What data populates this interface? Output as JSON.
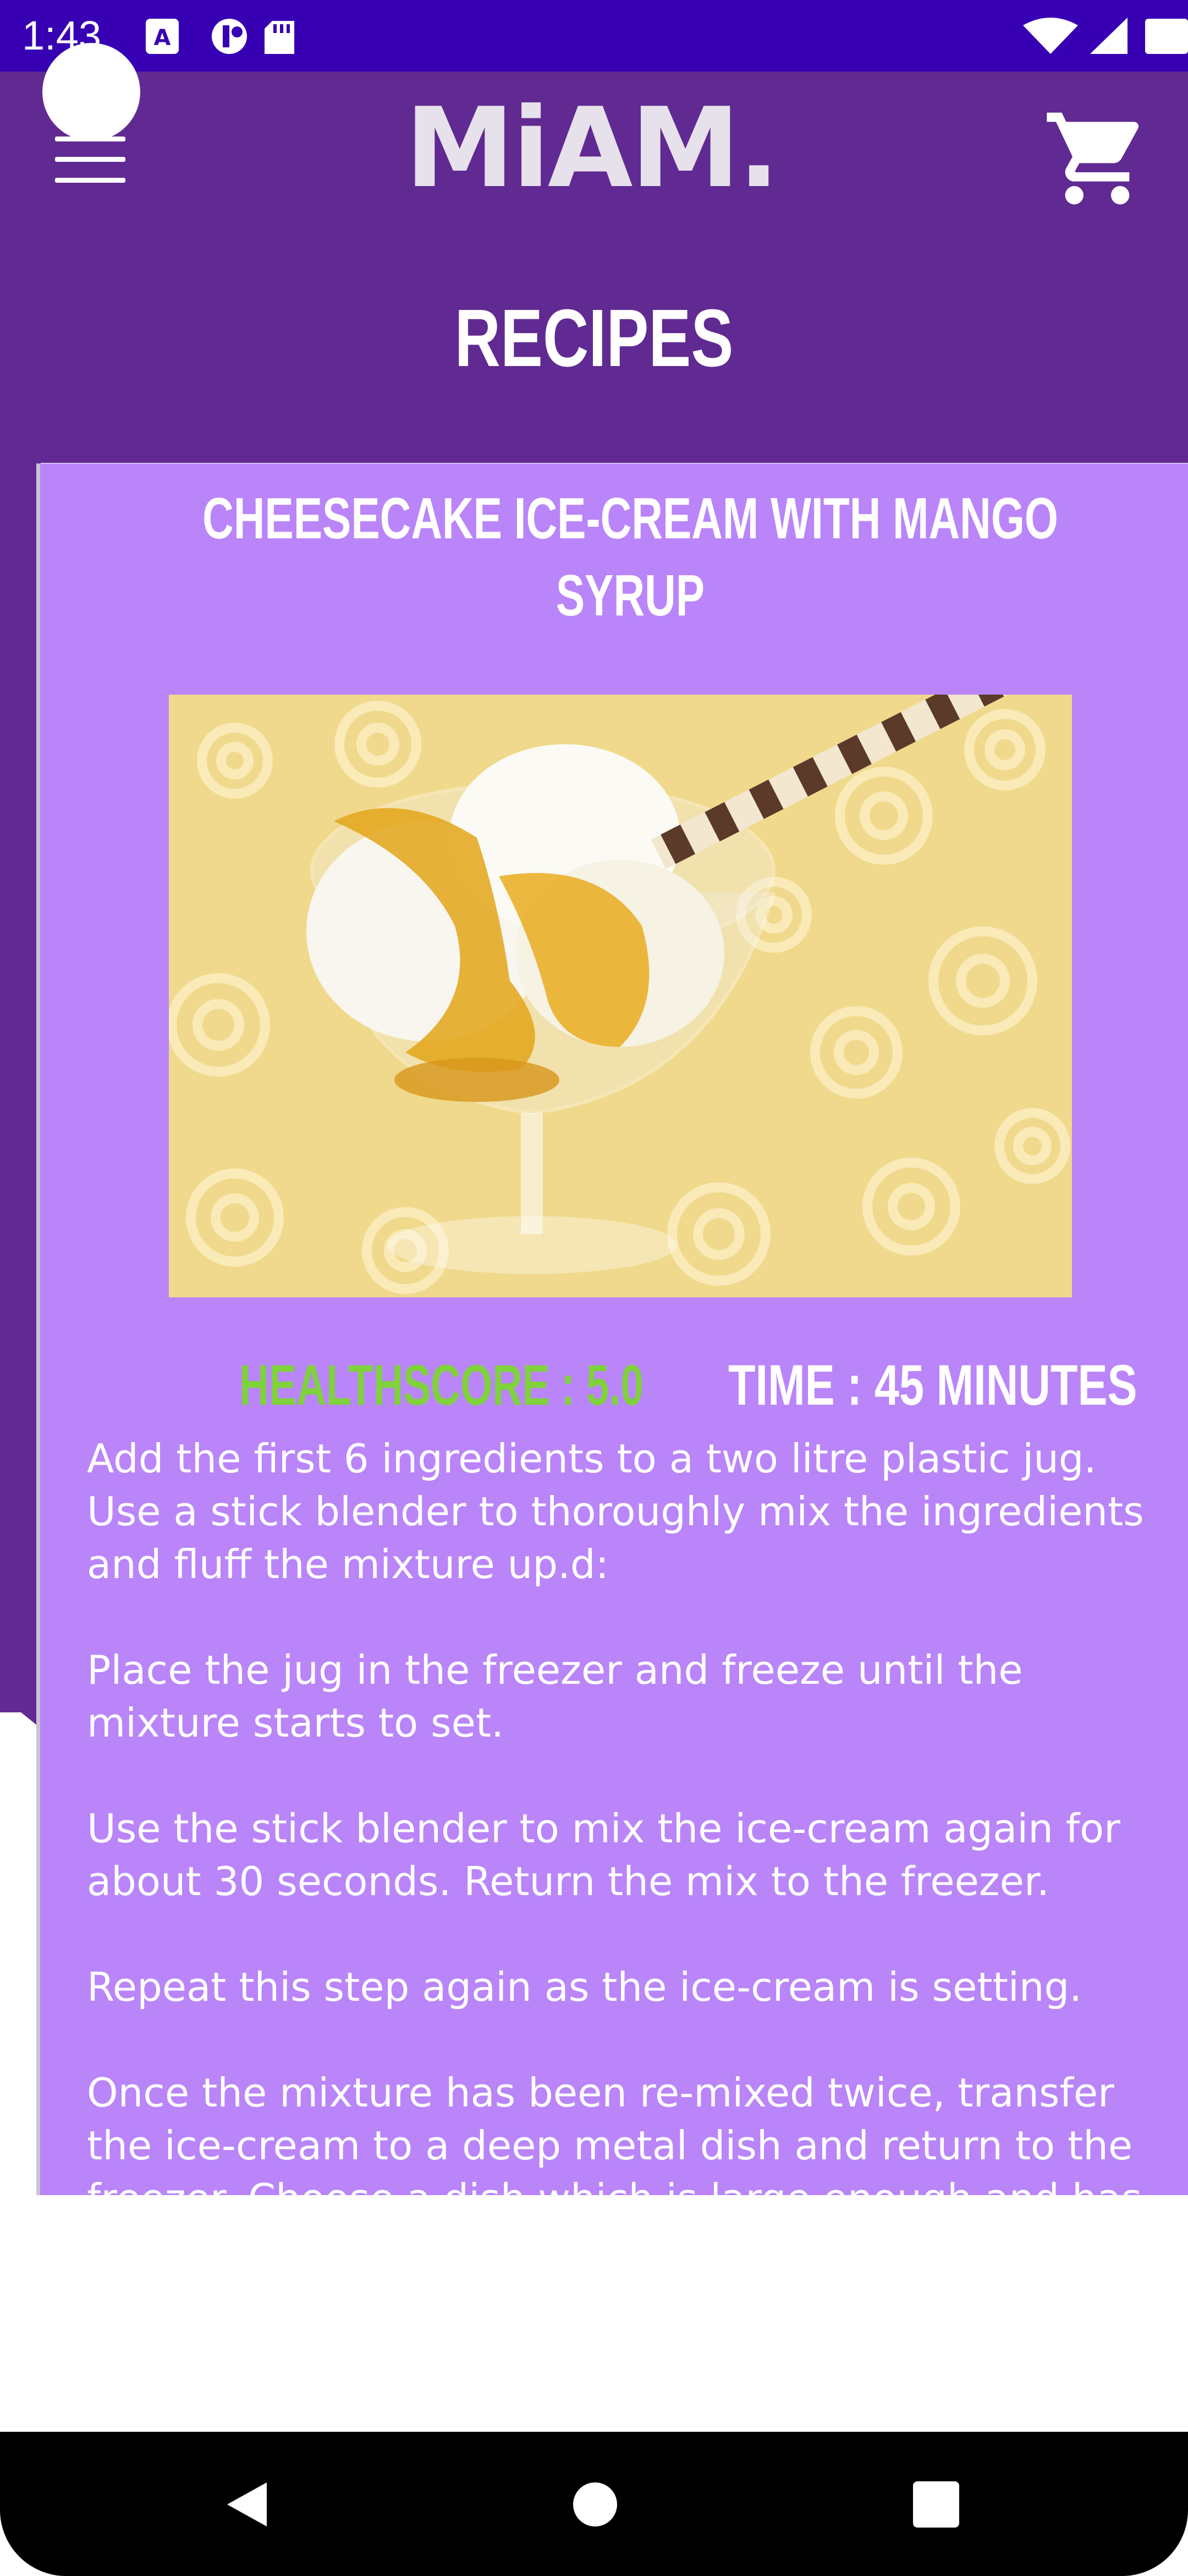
{
  "status_bar": {
    "time": "1:43",
    "icons": [
      "sim-a-icon",
      "data-saver-icon",
      "sd-card-icon",
      "wifi-icon",
      "signal-icon",
      "battery-icon"
    ]
  },
  "header": {
    "logo_text": "MiAM.",
    "page_title": "RECIPES",
    "menu_icon": "hamburger-menu-icon",
    "cart_icon": "shopping-cart-icon"
  },
  "recipe": {
    "title": "CHEESECAKE ICE-CREAM WITH MANGO SYRUP",
    "image_alt": "Cheesecake ice-cream in a glass with mango syrup and a wafer stick",
    "healthscore_label": "HEALTHSCORE : 5.0",
    "time_label": "TIME : 45 MINUTES",
    "instructions": [
      "Add the first 6 ingredients to a two litre plastic jug. Use a stick blender to thoroughly mix the ingredients and fluff the mixture up.d:",
      "Place the jug in the freezer and freeze until the mixture starts to set.",
      "Use the stick blender to mix the ice-cream again for about 30 seconds. Return the mix to the freezer.",
      "Repeat this step again as the ice-cream is setting.",
      "Once the mixture has been re-mixed twice, transfer the ice-cream to a deep metal dish and return to the freezer. Choose a dish which is large enough and has"
    ]
  },
  "colors": {
    "status_bar": "#3700b3",
    "app_bar": "#612a92",
    "card": "#b985f9",
    "healthscore": "#7fd23b",
    "text": "#ffffff"
  },
  "nav": {
    "back_icon": "back-triangle-icon",
    "home_icon": "home-circle-icon",
    "recents_icon": "recents-square-icon"
  }
}
